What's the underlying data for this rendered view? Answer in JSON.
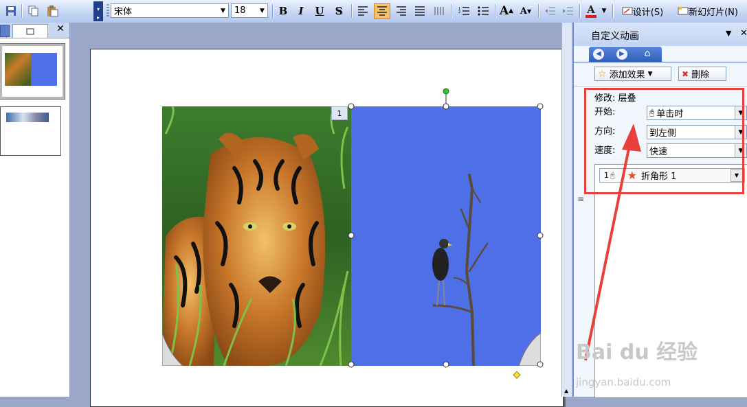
{
  "toolbar": {
    "font_name": "宋体",
    "font_size": "18",
    "bold": "B",
    "italic": "I",
    "underline": "U",
    "shadow": "S",
    "grow_font": "A",
    "shrink_font": "A",
    "design_label": "设计(S)",
    "new_slide_label": "新幻灯片(N)"
  },
  "slide": {
    "animation_tag": "1"
  },
  "taskpane": {
    "title": "自定义动画",
    "add_effect": "添加效果",
    "delete": "删除",
    "modify_label": "修改: 层叠",
    "start_label": "开始:",
    "start_value": "单击时",
    "direction_label": "方向:",
    "direction_value": "到左侧",
    "speed_label": "速度:",
    "speed_value": "快速",
    "list_item_num": "1",
    "list_item_name": "折角形 1"
  },
  "watermark": {
    "brand": "Bai du 经验",
    "url": "jingyan.baidu.com"
  },
  "colors": {
    "accent_red": "#e8403c",
    "sky_blue": "#4f6fe6",
    "toolbar_blue": "#c3d5f4"
  }
}
